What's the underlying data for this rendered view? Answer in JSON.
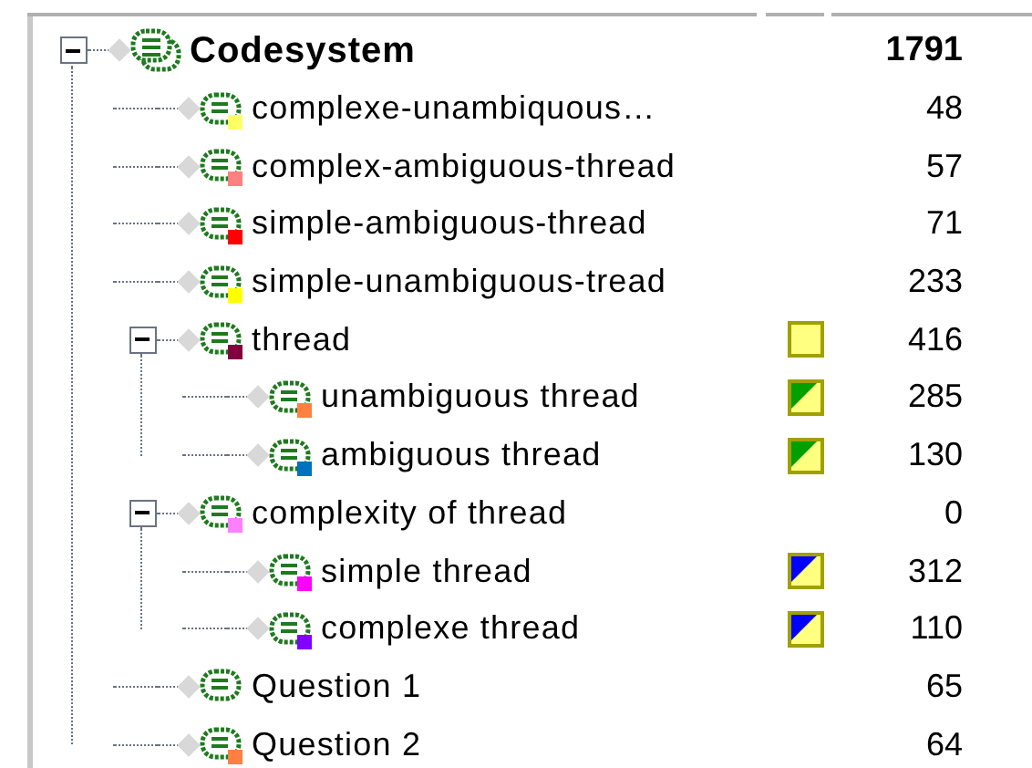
{
  "tree": {
    "label": "Codesystem",
    "count": "1791",
    "expanded": true,
    "kind": "root",
    "children": [
      {
        "label": "complexe-unambiquous…",
        "count": "48",
        "kind": "code",
        "color": "#ffff66"
      },
      {
        "label": "complex-ambiguous-thread",
        "count": "57",
        "kind": "code",
        "color": "#ff8080"
      },
      {
        "label": "simple-ambiguous-thread",
        "count": "71",
        "kind": "code",
        "color": "#ff0000"
      },
      {
        "label": "simple-unambiguous-tread",
        "count": "233",
        "kind": "code",
        "color": "#ffff00"
      },
      {
        "label": "thread",
        "count": "416",
        "kind": "code",
        "color": "#800040",
        "expanded": true,
        "marker": {
          "kind": "plain"
        },
        "children": [
          {
            "label": "unambiguous thread",
            "count": "285",
            "kind": "code",
            "color": "#ff8040",
            "marker": {
              "kind": "corner",
              "color": "#00a000"
            }
          },
          {
            "label": "ambiguous thread",
            "count": "130",
            "kind": "code",
            "color": "#0070c0",
            "marker": {
              "kind": "corner",
              "color": "#00a000"
            }
          }
        ]
      },
      {
        "label": "complexity of thread",
        "count": "0",
        "kind": "code",
        "color": "#ff80ff",
        "expanded": true,
        "children": [
          {
            "label": "simple thread",
            "count": "312",
            "kind": "code",
            "color": "#ff00ff",
            "marker": {
              "kind": "corner",
              "color": "#0000ff"
            }
          },
          {
            "label": "complexe thread",
            "count": "110",
            "kind": "code",
            "color": "#8000ff",
            "marker": {
              "kind": "corner",
              "color": "#0000ff"
            }
          }
        ]
      },
      {
        "label": "Question 1",
        "count": "65",
        "kind": "code"
      },
      {
        "label": "Question 2",
        "count": "64",
        "kind": "code",
        "color": "#ff8040"
      }
    ]
  }
}
